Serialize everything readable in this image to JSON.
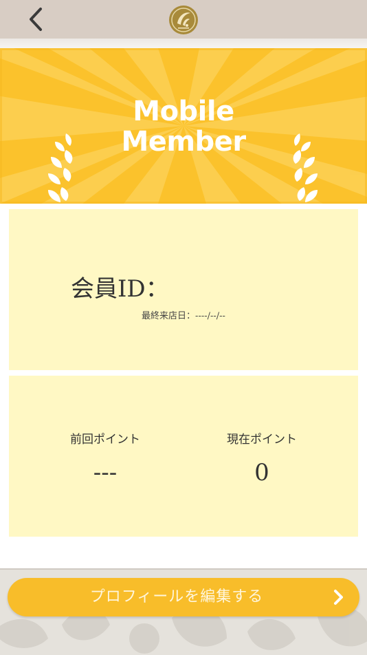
{
  "header": {
    "back_icon": "chevron-left-icon",
    "logo_icon": "shop-logo-icon"
  },
  "banner": {
    "title_line1": "Mobile",
    "title_line2": "Member",
    "icons": [
      "laurel-left-icon",
      "laurel-right-icon"
    ],
    "colors": {
      "background": "#fbc22c",
      "rays": "#fdd35a",
      "text": "#ffffff"
    }
  },
  "member_card": {
    "id_label": "会員ID：",
    "last_visit_label": "最終来店日：----/--/--"
  },
  "points_card": {
    "previous_label": "前回ポイント",
    "previous_value": "---",
    "current_label": "現在ポイント",
    "current_value": "0"
  },
  "footer": {
    "edit_profile_label": "プロフィールを編集する",
    "edit_profile_icon": "chevron-right-icon",
    "colors": {
      "button": "#f8bd2a"
    }
  },
  "colors": {
    "card_background": "#fff8c4",
    "header_background": "#d8cdc4"
  }
}
